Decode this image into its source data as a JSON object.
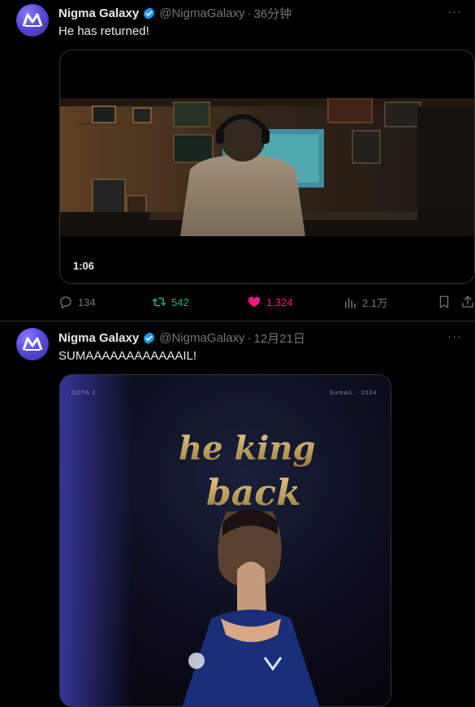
{
  "tweets": [
    {
      "author_name": "Nigma Galaxy",
      "handle": "@NigmaGalaxy",
      "separator": "·",
      "time": "36分钟",
      "more": "···",
      "text": "He has returned!",
      "media": {
        "type": "video",
        "duration": "1:06"
      },
      "actions": {
        "replies": "134",
        "retweets": "542",
        "likes": "1,324",
        "views": "2.1万"
      }
    },
    {
      "author_name": "Nigma Galaxy",
      "handle": "@NigmaGalaxy",
      "separator": "·",
      "time": "12月21日",
      "more": "···",
      "text": "SUMAAAAAAAAAAAAIL!",
      "media": {
        "type": "image",
        "brand": "DOTA 2",
        "tag": "SumaiL · 2024",
        "headline": [
          "he king",
          "back"
        ]
      }
    }
  ],
  "colors": {
    "background": "#000000",
    "text": "#e7e9ea",
    "muted": "#71767b",
    "retweet_active": "#00ba7c",
    "like_active": "#f91880",
    "verified": "#1d9bf0",
    "divider": "#2f3336"
  },
  "icons": [
    "verified-badge-icon",
    "reply-icon",
    "retweet-icon",
    "heart-icon",
    "views-icon",
    "bookmark-icon",
    "share-icon"
  ]
}
